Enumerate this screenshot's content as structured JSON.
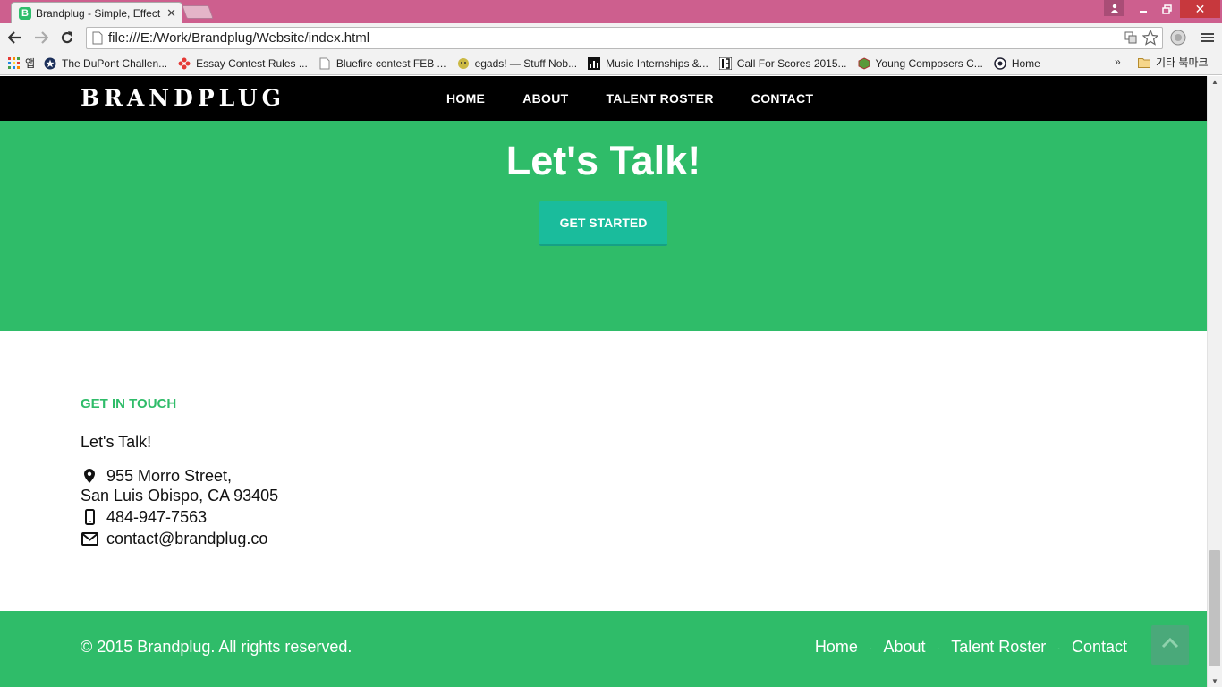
{
  "browser": {
    "tab_title": "Brandplug - Simple, Effect",
    "tab_favicon": "B",
    "url": "file:///E:/Work/Brandplug/Website/index.html",
    "apps_label": "앱",
    "bookmarks": [
      {
        "label": "The DuPont Challen...",
        "icon": "star-badge-icon"
      },
      {
        "label": "Essay Contest Rules ...",
        "icon": "flower-icon"
      },
      {
        "label": "Bluefire contest FEB ...",
        "icon": "page-icon"
      },
      {
        "label": "egads! — Stuff Nob...",
        "icon": "egads-icon"
      },
      {
        "label": "Music Internships &...",
        "icon": "equalizer-icon"
      },
      {
        "label": "Call For Scores 2015...",
        "icon": "score-icon"
      },
      {
        "label": "Young Composers C...",
        "icon": "cube-icon"
      },
      {
        "label": "Home",
        "icon": "globe-icon"
      }
    ],
    "bookmarks_more": "»",
    "other_bookmarks": "기타 북마크"
  },
  "site": {
    "brand": "BRANDPLUG",
    "nav": [
      "HOME",
      "ABOUT",
      "TALENT ROSTER",
      "CONTACT"
    ],
    "hero_title": "Let's Talk!",
    "cta_label": "GET STARTED",
    "contact": {
      "heading": "GET IN TOUCH",
      "subheading": "Let's Talk!",
      "address_line1": "955 Morro Street,",
      "address_line2": "San Luis Obispo, CA 93405",
      "phone": "484-947-7563",
      "email": "contact@brandplug.co"
    },
    "footer": {
      "copyright": "© 2015 Brandplug. All rights reserved.",
      "links": [
        "Home",
        "About",
        "Talent Roster",
        "Contact"
      ]
    }
  },
  "colors": {
    "brand_green": "#2fbc69",
    "cta_teal": "#1abc9c",
    "chrome_frame": "#cd5f8e",
    "nav_black": "#000000"
  }
}
